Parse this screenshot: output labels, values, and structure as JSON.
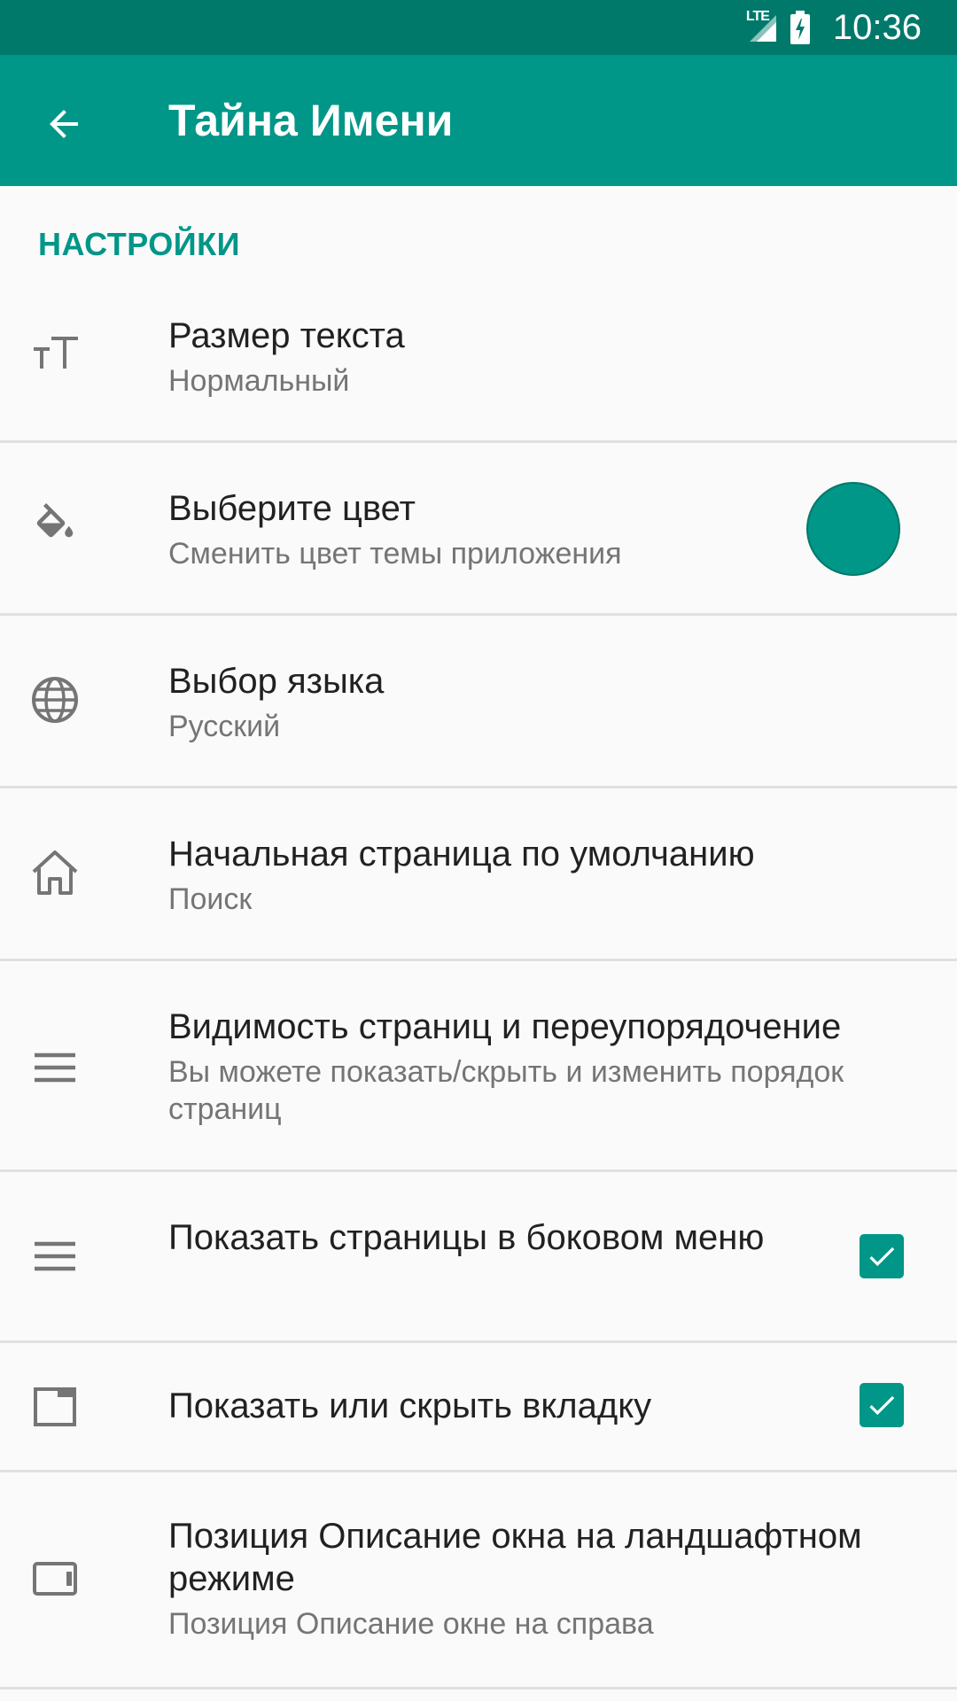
{
  "status_bar": {
    "network": "LTE",
    "time": "10:36",
    "icons": [
      "signal-icon",
      "battery-charging-icon"
    ]
  },
  "app_bar": {
    "title": "Тайна Имени",
    "back_icon": "arrow-back-icon"
  },
  "section": {
    "title": "НАСТРОЙКИ"
  },
  "settings": [
    {
      "icon": "text-size-icon",
      "title": "Размер текста",
      "summary": "Нормальный"
    },
    {
      "icon": "paint-bucket-icon",
      "title": "Выберите цвет",
      "summary": "Сменить цвет темы приложения",
      "color": "#009688"
    },
    {
      "icon": "globe-icon",
      "title": "Выбор языка",
      "summary": "Русский"
    },
    {
      "icon": "home-icon",
      "title": "Начальная страница по умолчанию",
      "summary": "Поиск"
    },
    {
      "icon": "menu-icon",
      "title": "Видимость страниц и переупорядочение",
      "summary": "Вы можете показать/скрыть и изменить порядок страниц"
    },
    {
      "icon": "menu-icon",
      "title": "Показать страницы в боковом меню",
      "checked": true
    },
    {
      "icon": "tab-icon",
      "title": "Показать или скрыть вкладку",
      "checked": true
    },
    {
      "icon": "landscape-icon",
      "title": "Позиция Описание окна на ландшафтном режиме",
      "summary": "Позиция Описание окне на справа"
    }
  ],
  "colors": {
    "accent": "#009688",
    "status_bar": "#00796b",
    "background": "#fafafa"
  }
}
